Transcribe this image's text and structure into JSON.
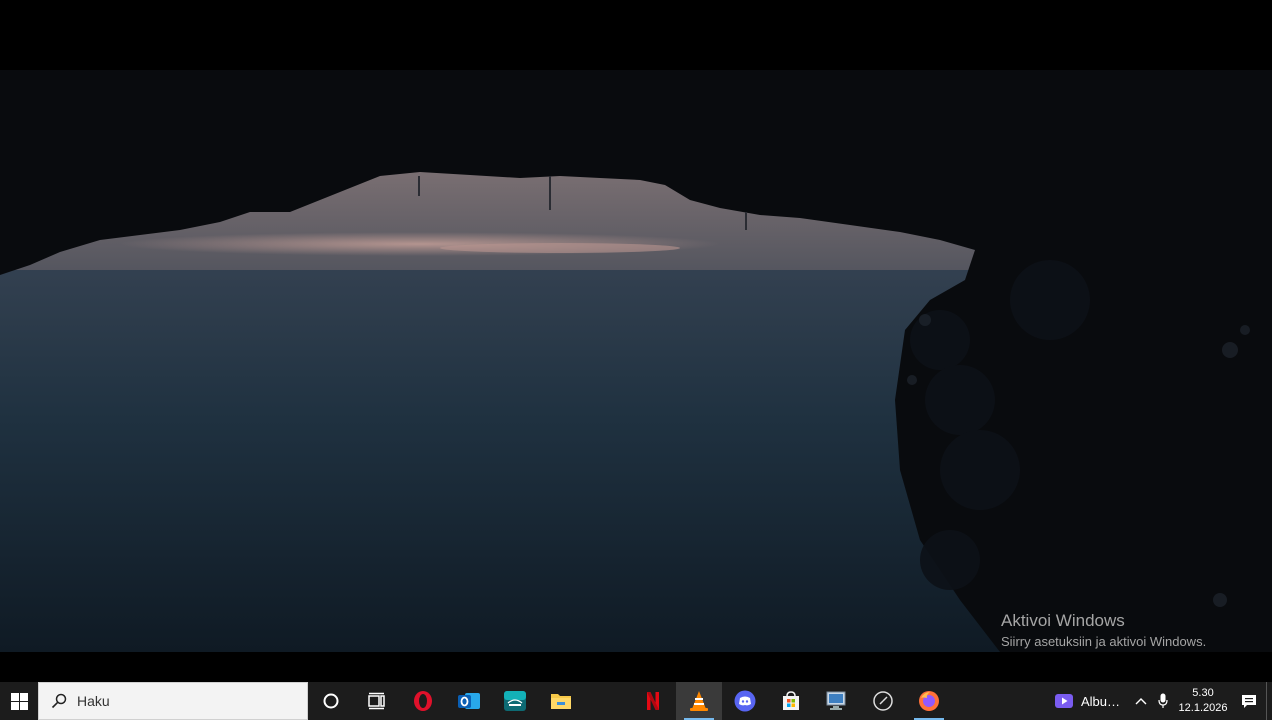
{
  "watermark": {
    "title": "Aktivoi Windows",
    "subtitle": "Siirry asetuksiin ja aktivoi Windows."
  },
  "taskbar": {
    "search_placeholder": "Haku",
    "icons": [
      "windows-start-icon",
      "search-icon",
      "cortana-icon",
      "task-view-icon",
      "opera-icon",
      "outlook-icon",
      "disney-plus-icon",
      "file-explorer-icon",
      "netflix-icon",
      "vlc-icon",
      "discord-icon",
      "microsoft-store-icon",
      "remote-desktop-icon",
      "clock-app-icon",
      "firefox-icon"
    ],
    "active_app": "vlc",
    "accent_color": "#76b9ed"
  },
  "tray": {
    "media_label": "Albu…",
    "time": "5.30",
    "date": "12.1.2026"
  }
}
